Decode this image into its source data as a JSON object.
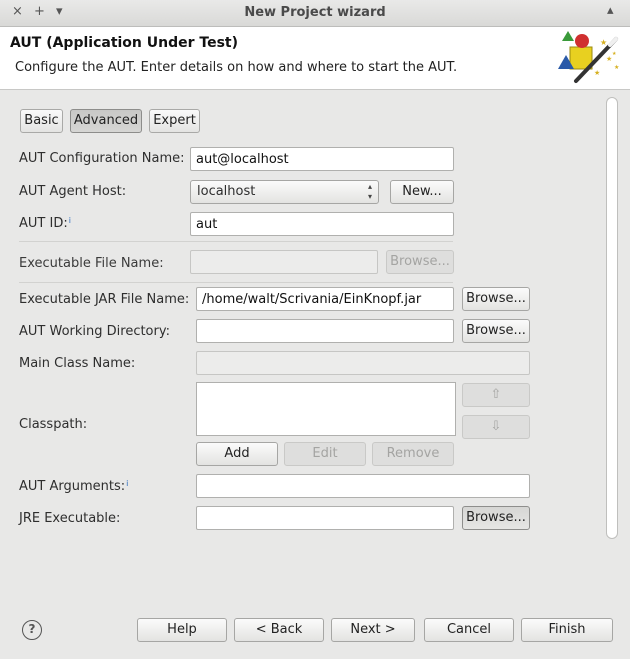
{
  "window": {
    "title": "New Project wizard",
    "controls": [
      "×",
      "+",
      "▾"
    ]
  },
  "banner": {
    "heading": "AUT (Application Under Test)",
    "description": "Configure the AUT. Enter details on how and where to start the AUT.",
    "icon": "wizard-wand-icon"
  },
  "tabs": [
    {
      "label": "Basic",
      "active": false
    },
    {
      "label": "Advanced",
      "active": true
    },
    {
      "label": "Expert",
      "active": false
    }
  ],
  "form": {
    "config_name": {
      "label": "AUT Configuration Name:",
      "value": "aut@localhost"
    },
    "agent_host": {
      "label": "AUT Agent Host:",
      "value": "localhost",
      "new_button": "New..."
    },
    "aut_id": {
      "label": "AUT ID:",
      "value": "aut",
      "info": "i"
    },
    "executable": {
      "label": "Executable File Name:",
      "value": "",
      "browse": "Browse..."
    },
    "jar": {
      "label": "Executable JAR File Name:",
      "value": "/home/walt/Scrivania/EinKnopf.jar",
      "browse": "Browse..."
    },
    "working_dir": {
      "label": "AUT Working Directory:",
      "value": "",
      "browse": "Browse..."
    },
    "main_class": {
      "label": "Main Class Name:",
      "value": ""
    },
    "classpath": {
      "label": "Classpath:",
      "up": "⇧",
      "down": "⇩",
      "add": "Add",
      "edit": "Edit",
      "remove": "Remove"
    },
    "arguments": {
      "label": "AUT Arguments:",
      "value": "",
      "info": "i"
    },
    "jre": {
      "label": "JRE Executable:",
      "value": "",
      "browse": "Browse..."
    }
  },
  "footer": {
    "help_icon": "?",
    "help": "Help",
    "back": "< Back",
    "next": "Next >",
    "cancel": "Cancel",
    "finish": "Finish"
  }
}
